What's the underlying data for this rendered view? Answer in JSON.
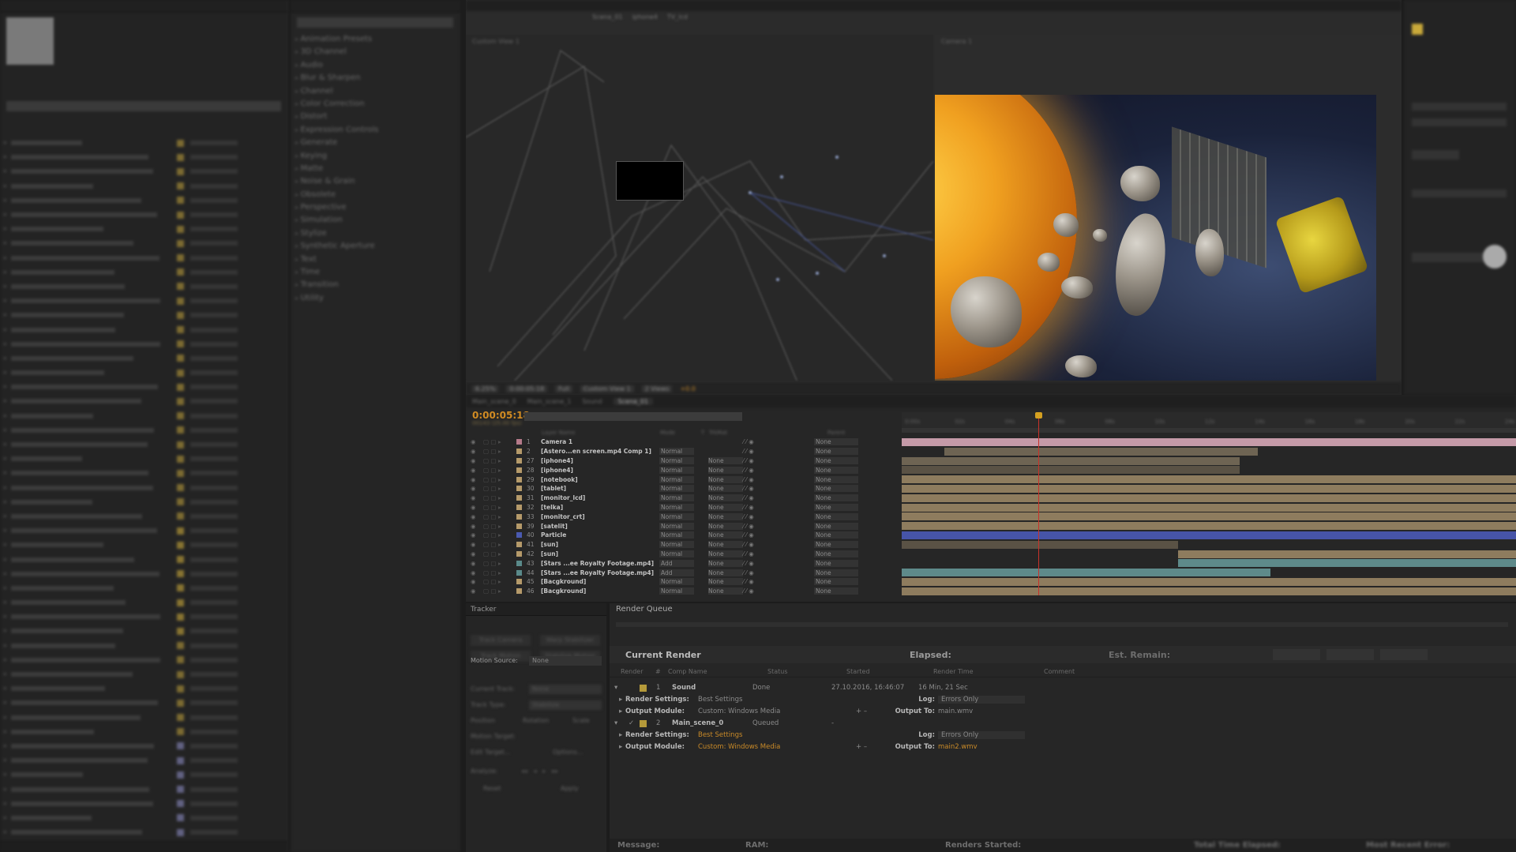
{
  "effects_presets": {
    "categories": [
      "Animation Presets",
      "3D Channel",
      "Audio",
      "Blur & Sharpen",
      "Channel",
      "Color Correction",
      "Distort",
      "Expression Controls",
      "Generate",
      "Keying",
      "Matte",
      "Noise & Grain",
      "Obsolete",
      "Perspective",
      "Simulation",
      "Stylize",
      "Synthetic Aperture",
      "Text",
      "Time",
      "Transition",
      "Utility"
    ]
  },
  "viewer": {
    "left_view_label": "Custom View 1",
    "right_view_label": "Camera 1",
    "breadcrumbs": [
      "Scena_01",
      "iphone4",
      "TV_lcd"
    ],
    "toolbar": {
      "zoom": "6.25%",
      "timecode": "0:00:05:18",
      "resolution": "Full",
      "view": "Custom View 1",
      "layout": "2 Views",
      "exposure": "+0.0"
    }
  },
  "timeline": {
    "tabs": [
      "Main_scene_0",
      "Main_scene_1",
      "Sound",
      "Scena_01"
    ],
    "active_tab": "Scena_01",
    "timecode": "0:00:05:18",
    "timecode_sub": "00143 (25.00 fps)",
    "columns": {
      "layer_name": "Layer Name",
      "mode": "Mode",
      "trkmat": "TrkMat",
      "parent": "Parent",
      "t": "T"
    },
    "ruler_ticks": [
      "0:00s",
      "02s",
      "04s",
      "06s",
      "08s",
      "10s",
      "12s",
      "14s",
      "16s",
      "18s",
      "20s",
      "22s",
      "24s"
    ],
    "layers": [
      {
        "num": "1",
        "name": "Camera 1",
        "mode": "",
        "trkmat": "",
        "parent": "None",
        "label": "#b57a8a",
        "bar": {
          "start": 0,
          "end": 1,
          "color": "#c59aa8"
        }
      },
      {
        "num": "2",
        "name": "[Astero...en screen.mp4 Comp 1]",
        "mode": "Normal",
        "trkmat": "",
        "parent": "None",
        "label": "#b59a6a",
        "bar": {
          "start": 0.07,
          "end": 0.58,
          "color": "#6e6453"
        }
      },
      {
        "num": "27",
        "name": "[iphone4]",
        "mode": "Normal",
        "trkmat": "None",
        "parent": "None",
        "label": "#b59a6a",
        "bar": {
          "start": 0,
          "end": 0.55,
          "color": "#6e6453"
        }
      },
      {
        "num": "28",
        "name": "[iphone4]",
        "mode": "Normal",
        "trkmat": "None",
        "parent": "None",
        "label": "#b59a6a",
        "bar": {
          "start": 0,
          "end": 0.55,
          "color": "#5a5245"
        }
      },
      {
        "num": "29",
        "name": "[notebook]",
        "mode": "Normal",
        "trkmat": "None",
        "parent": "None",
        "label": "#b59a6a",
        "bar": {
          "start": 0,
          "end": 1,
          "color": "#8e7c5e"
        }
      },
      {
        "num": "30",
        "name": "[tablet]",
        "mode": "Normal",
        "trkmat": "None",
        "parent": "None",
        "label": "#b59a6a",
        "bar": {
          "start": 0,
          "end": 1,
          "color": "#8e7c5e"
        }
      },
      {
        "num": "31",
        "name": "[monitor_lcd]",
        "mode": "Normal",
        "trkmat": "None",
        "parent": "None",
        "label": "#b59a6a",
        "bar": {
          "start": 0,
          "end": 1,
          "color": "#8e7c5e"
        }
      },
      {
        "num": "32",
        "name": "[telka]",
        "mode": "Normal",
        "trkmat": "None",
        "parent": "None",
        "label": "#b59a6a",
        "bar": {
          "start": 0,
          "end": 1,
          "color": "#8e7c5e"
        }
      },
      {
        "num": "33",
        "name": "[monitor_crt]",
        "mode": "Normal",
        "trkmat": "None",
        "parent": "None",
        "label": "#b59a6a",
        "bar": {
          "start": 0,
          "end": 1,
          "color": "#8e7c5e"
        }
      },
      {
        "num": "39",
        "name": "[satelit]",
        "mode": "Normal",
        "trkmat": "None",
        "parent": "None",
        "label": "#b59a6a",
        "bar": {
          "start": 0,
          "end": 1,
          "color": "#8e7c5e"
        }
      },
      {
        "num": "40",
        "name": "Particle",
        "mode": "Normal",
        "trkmat": "None",
        "parent": "None",
        "label": "#4a5ab0",
        "bar": {
          "start": 0,
          "end": 1,
          "color": "#4654a8"
        }
      },
      {
        "num": "41",
        "name": "[sun]",
        "mode": "Normal",
        "trkmat": "None",
        "parent": "None",
        "label": "#b59a6a",
        "bar": {
          "start": 0,
          "end": 0.45,
          "color": "#5a5245"
        }
      },
      {
        "num": "42",
        "name": "[sun]",
        "mode": "Normal",
        "trkmat": "None",
        "parent": "None",
        "label": "#b59a6a",
        "bar": {
          "start": 0.45,
          "end": 1,
          "color": "#8e7c5e"
        }
      },
      {
        "num": "43",
        "name": "[Stars ...ee Royalty Footage.mp4]",
        "mode": "Add",
        "trkmat": "None",
        "parent": "None",
        "label": "#5a8a8a",
        "bar": {
          "start": 0.45,
          "end": 1,
          "color": "#5e8a8a"
        }
      },
      {
        "num": "44",
        "name": "[Stars ...ee Royalty Footage.mp4]",
        "mode": "Add",
        "trkmat": "None",
        "parent": "None",
        "label": "#5a8a8a",
        "bar": {
          "start": 0,
          "end": 0.6,
          "color": "#5e8a8a"
        }
      },
      {
        "num": "45",
        "name": "[Bacgkround]",
        "mode": "Normal",
        "trkmat": "None",
        "parent": "None",
        "label": "#b59a6a",
        "bar": {
          "start": 0,
          "end": 1,
          "color": "#8e7c5e"
        }
      },
      {
        "num": "46",
        "name": "[Bacgkround]",
        "mode": "Normal",
        "trkmat": "None",
        "parent": "None",
        "label": "#b59a6a",
        "bar": {
          "start": 0,
          "end": 1,
          "color": "#8e7c5e"
        }
      }
    ]
  },
  "tracker": {
    "title": "Tracker",
    "buttons": [
      "Track Camera",
      "Warp Stabilizer",
      "Track Motion",
      "Stabilize Motion"
    ],
    "motion_source_label": "Motion Source:",
    "motion_source_value": "None",
    "current_track_label": "Current Track:",
    "current_track_value": "None",
    "track_type_label": "Track Type:",
    "track_type_value": "Stabilize",
    "options": [
      "Position",
      "Rotation",
      "Scale"
    ],
    "motion_target_label": "Motion Target:",
    "edit_target": "Edit Target...",
    "options_btn": "Options...",
    "analyze_label": "Analyze:",
    "reset": "Reset",
    "apply": "Apply"
  },
  "render_queue": {
    "tab": "Render Queue",
    "current_render": "Current Render",
    "elapsed_label": "Elapsed:",
    "est_remain_label": "Est. Remain:",
    "columns": [
      "Render",
      "#",
      "Comp Name",
      "Status",
      "Started",
      "Render Time",
      "Comment"
    ],
    "items": [
      {
        "num": "1",
        "comp": "Sound",
        "status": "Done",
        "started": "27.10.2016, 16:46:07",
        "render_time": "16 Min, 21 Sec",
        "render_settings": "Best Settings",
        "output_module": "Custom: Windows Media",
        "log": "Errors Only",
        "output_to": "main.wmv"
      },
      {
        "num": "2",
        "comp": "Main_scene_0",
        "status": "Queued",
        "started": "-",
        "render_time": "",
        "render_settings": "Best Settings",
        "output_module": "Custom: Windows Media",
        "log": "Errors Only",
        "output_to": "main2.wmv"
      }
    ],
    "labels": {
      "render_settings": "Render Settings:",
      "output_module": "Output Module:",
      "log": "Log:",
      "output_to": "Output To:"
    }
  },
  "status_bar": {
    "message": "Message:",
    "ram": "RAM:",
    "renders_started": "Renders Started:",
    "total_time": "Total Time Elapsed:",
    "recent_error": "Most Recent Error:"
  }
}
